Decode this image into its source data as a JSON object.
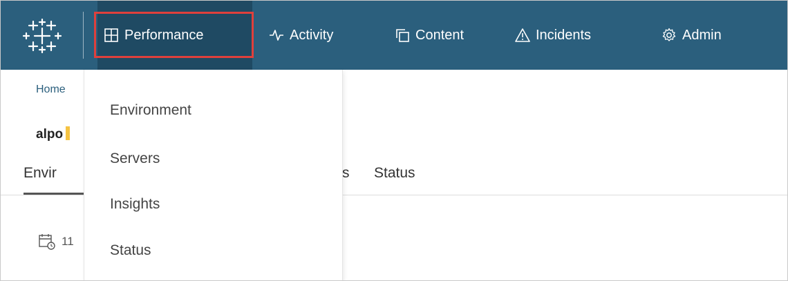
{
  "topnav": {
    "items": [
      {
        "label": "Performance",
        "icon": "grid-icon"
      },
      {
        "label": "Activity",
        "icon": "pulse-icon"
      },
      {
        "label": "Content",
        "icon": "copy-icon"
      },
      {
        "label": "Incidents",
        "icon": "warning-icon"
      },
      {
        "label": "Admin",
        "icon": "gear-icon"
      }
    ],
    "active": "Performance",
    "highlight_color": "#e0403c",
    "bar_color": "#2b5f7d"
  },
  "breadcrumb": {
    "home": "Home"
  },
  "page": {
    "title": "alpo"
  },
  "tabs": [
    {
      "label": "Envir"
    },
    {
      "label": "s"
    },
    {
      "label": "Status"
    }
  ],
  "date_row": {
    "text": "11",
    "icon": "calendar-clock-icon"
  },
  "dropdown": {
    "items": [
      "Environment",
      "Servers",
      "Insights",
      "Status"
    ]
  }
}
